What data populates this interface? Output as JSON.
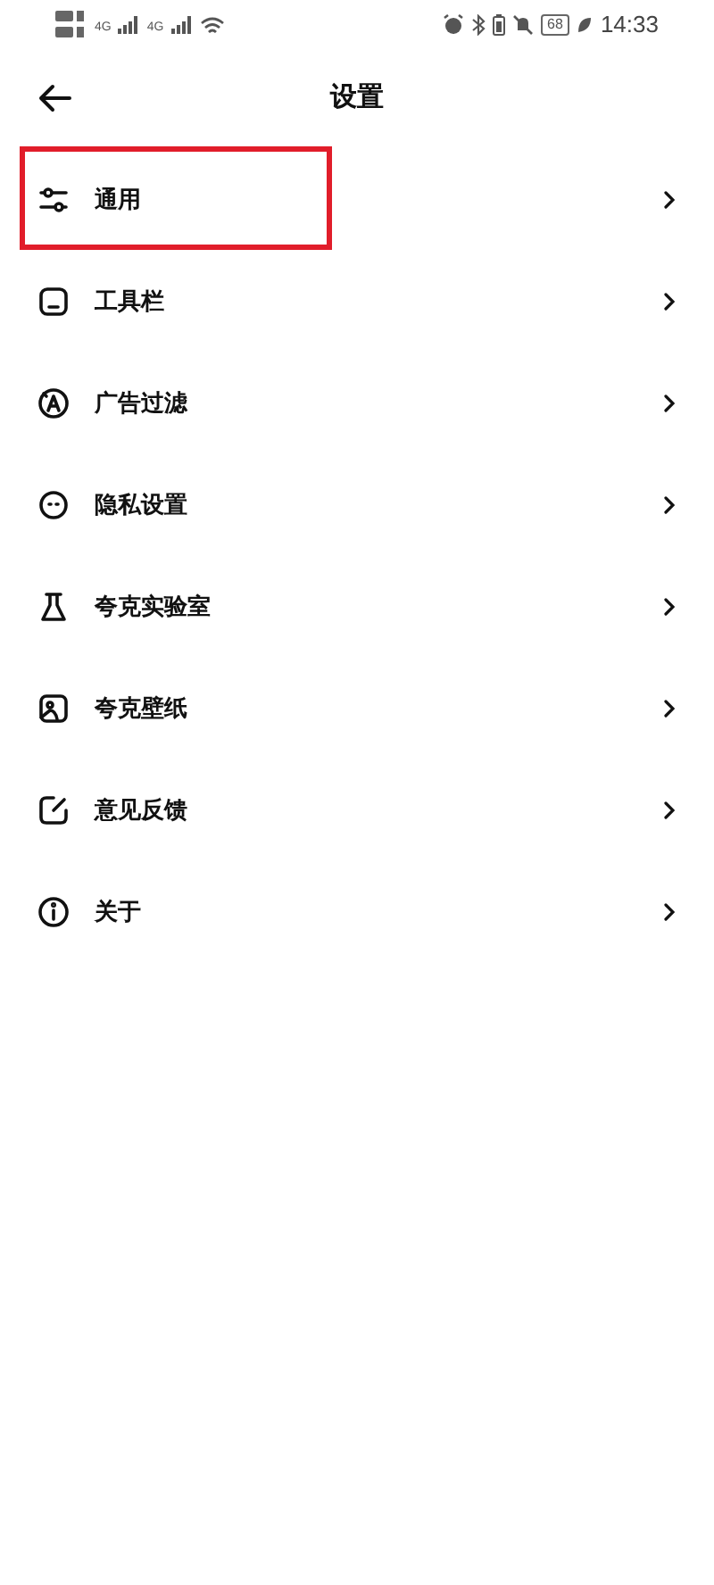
{
  "status_bar": {
    "network_1": "4G",
    "network_2": "4G",
    "battery": "68",
    "time": "14:33"
  },
  "header": {
    "title": "设置"
  },
  "items": [
    {
      "label": "通用",
      "highlighted": true
    },
    {
      "label": "工具栏",
      "highlighted": false
    },
    {
      "label": "广告过滤",
      "highlighted": false
    },
    {
      "label": "隐私设置",
      "highlighted": false
    },
    {
      "label": "夸克实验室",
      "highlighted": false
    },
    {
      "label": "夸克壁纸",
      "highlighted": false
    },
    {
      "label": "意见反馈",
      "highlighted": false
    },
    {
      "label": "关于",
      "highlighted": false
    }
  ]
}
